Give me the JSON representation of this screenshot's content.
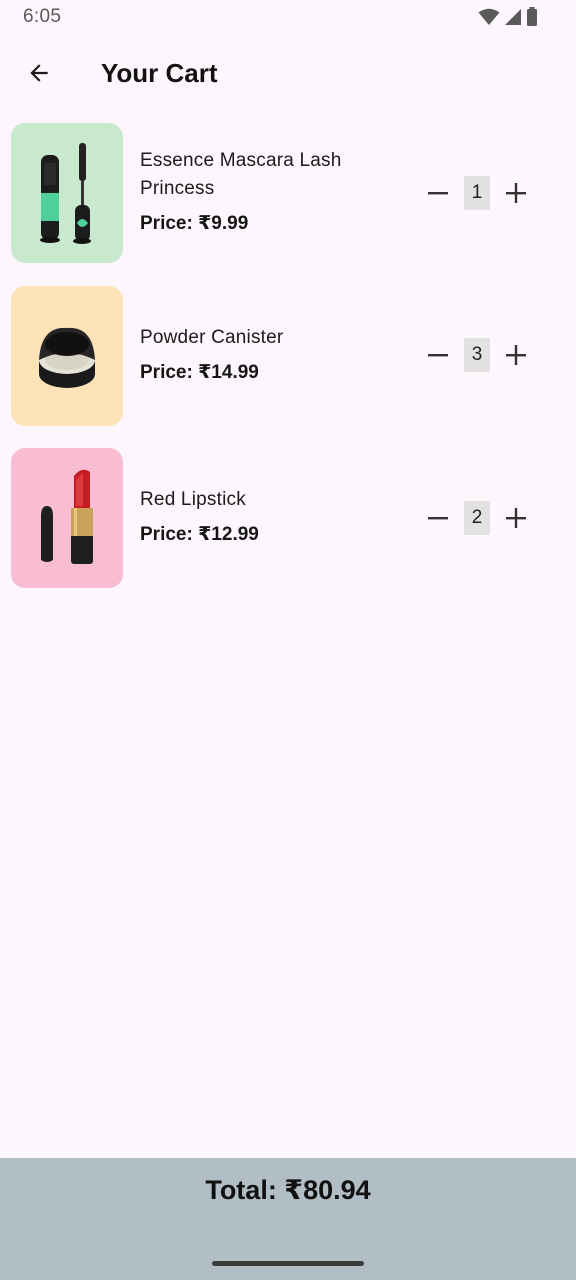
{
  "status": {
    "time": "6:05"
  },
  "header": {
    "title": "Your Cart"
  },
  "items": [
    {
      "name": "Essence Mascara Lash Princess",
      "price": "Price: ₹9.99",
      "qty": "1",
      "bg": "#c9e9cf"
    },
    {
      "name": "Powder Canister",
      "price": "Price: ₹14.99",
      "qty": "3",
      "bg": "#fde3b7"
    },
    {
      "name": "Red Lipstick",
      "price": "Price: ₹12.99",
      "qty": "2",
      "bg": "#f8bdd2"
    }
  ],
  "footer": {
    "total": "Total: ₹80.94"
  },
  "icons": {
    "back": "arrow-left-icon",
    "minus": "minus-icon",
    "plus": "plus-icon",
    "wifi": "wifi-icon",
    "signal": "signal-icon",
    "battery": "battery-icon"
  }
}
